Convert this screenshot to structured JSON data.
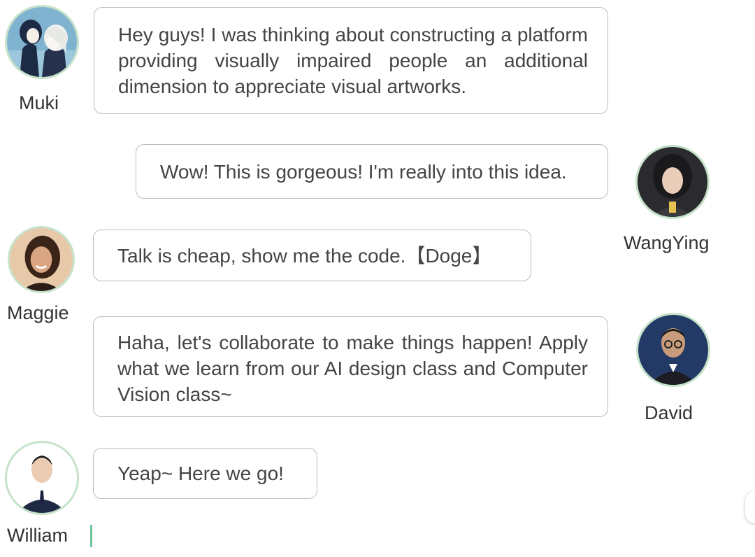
{
  "messages": [
    {
      "sender": "Muki",
      "text": "Hey guys! I was thinking about constructing a platform providing visually impaired people an additional dimension to appreciate visual artworks."
    },
    {
      "sender": "WangYing",
      "text": "Wow! This is gorgeous! I'm really into this idea."
    },
    {
      "sender": "Maggie",
      "text": "Talk is cheap, show me the code.【Doge】"
    },
    {
      "sender": "David",
      "text": "Haha, let's collaborate to make things happen! Apply what we learn from our AI design class and Computer Vision class~"
    },
    {
      "sender": "William",
      "text": "Yeap~ Here we go!"
    }
  ],
  "avatars": [
    {
      "name": "Muki",
      "icon": "anime-couple-avatar-icon",
      "colors": {
        "bg": "#7fb3cf",
        "hair": "#1d2a44"
      }
    },
    {
      "name": "WangYing",
      "icon": "woman-portrait-avatar-icon",
      "colors": {
        "bg": "#2b2b2f",
        "skin": "#e9cdb9"
      }
    },
    {
      "name": "Maggie",
      "icon": "woman-portrait-avatar-icon",
      "colors": {
        "bg": "#e7c9a9",
        "skin": "#d9a582"
      }
    },
    {
      "name": "David",
      "icon": "man-glasses-avatar-icon",
      "colors": {
        "bg": "#243a66",
        "skin": "#c89b7a"
      }
    },
    {
      "name": "William",
      "icon": "man-suit-avatar-icon",
      "colors": {
        "bg": "#ffffff",
        "skin": "#eccbb3"
      }
    }
  ],
  "theme": {
    "avatar_ring": "#c6e2c9",
    "bubble_border": "#bdbdbd",
    "caret": "#6cc59a"
  }
}
